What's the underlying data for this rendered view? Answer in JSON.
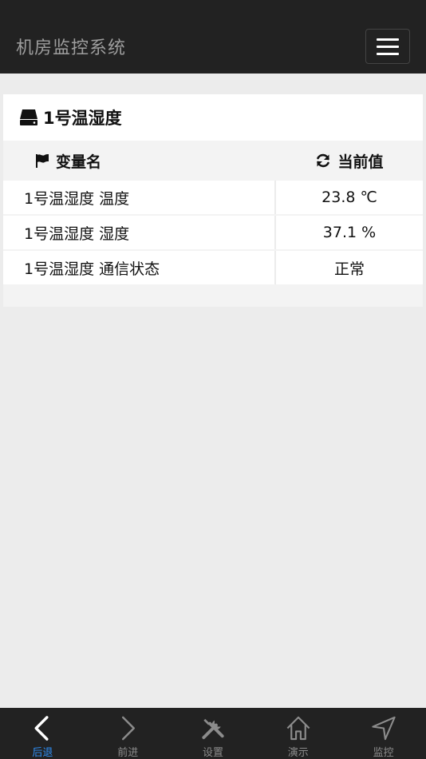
{
  "header": {
    "title": "机房监控系统"
  },
  "panel": {
    "title": "1号温湿度",
    "columns": {
      "name": "变量名",
      "value": "当前值"
    },
    "rows": [
      {
        "name": "1号温湿度 温度",
        "value": "23.8 ℃"
      },
      {
        "name": "1号温湿度 湿度",
        "value": "37.1 %"
      },
      {
        "name": "1号温湿度 通信状态",
        "value": "正常"
      }
    ]
  },
  "tabbar": {
    "items": [
      {
        "label": "后退",
        "icon": "back-icon"
      },
      {
        "label": "前进",
        "icon": "forward-icon"
      },
      {
        "label": "设置",
        "icon": "tools-icon"
      },
      {
        "label": "演示",
        "icon": "home-icon"
      },
      {
        "label": "监控",
        "icon": "navigate-icon"
      }
    ],
    "active_color": "#2f8ef4",
    "inactive_color": "#8c8c8c"
  }
}
